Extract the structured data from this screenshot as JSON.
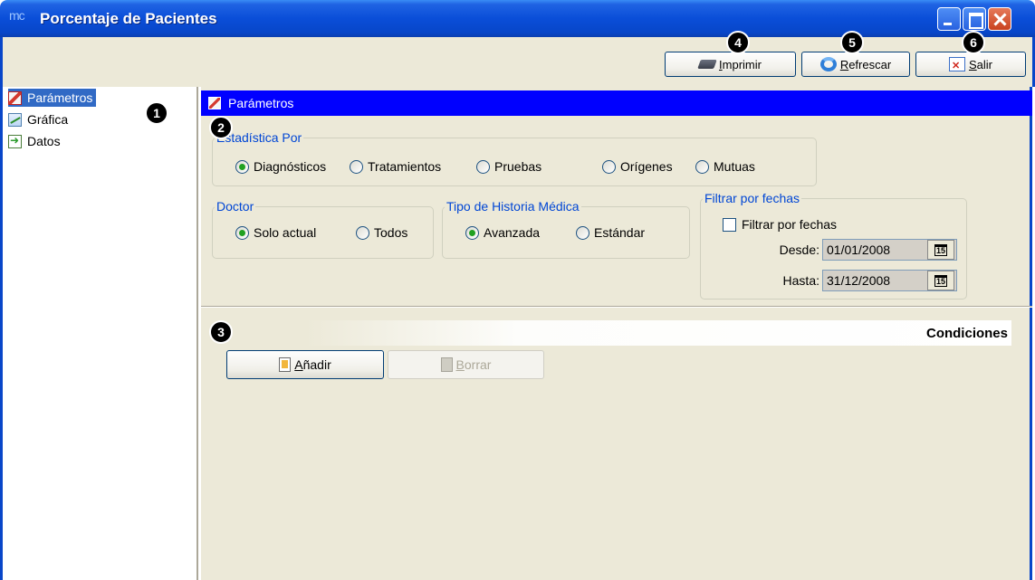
{
  "window": {
    "logo_text": "mc",
    "title": "Porcentaje de Pacientes"
  },
  "toolbar": {
    "print": {
      "mnemonic": "I",
      "rest": "mprimir",
      "icon": "printer-icon"
    },
    "refresh": {
      "mnemonic": "R",
      "rest": "efrescar",
      "icon": "refresh-icon"
    },
    "exit": {
      "mnemonic": "S",
      "rest": "alir",
      "icon": "exit-icon"
    }
  },
  "badges": [
    "1",
    "2",
    "3",
    "4",
    "5",
    "6"
  ],
  "sidebar": {
    "items": [
      {
        "label": "Parámetros",
        "icon": "parameters-icon",
        "selected": true
      },
      {
        "label": "Gráfica",
        "icon": "chart-icon",
        "selected": false
      },
      {
        "label": "Datos",
        "icon": "data-icon",
        "selected": false
      }
    ]
  },
  "main": {
    "header": "Parámetros",
    "statistic": {
      "legend": "Estadística Por",
      "options": [
        "Diagnósticos",
        "Tratamientos",
        "Pruebas",
        "Orígenes",
        "Mutuas"
      ],
      "selected": "Diagnósticos"
    },
    "doctor": {
      "legend": "Doctor",
      "options": [
        "Solo actual",
        "Todos"
      ],
      "selected": "Solo actual"
    },
    "history_type": {
      "legend": "Tipo de Historia Médica",
      "options": [
        "Avanzada",
        "Estándar"
      ],
      "selected": "Avanzada"
    },
    "date_filter": {
      "legend": "Filtrar por fechas",
      "checkbox_label": "Filtrar por fechas",
      "checked": false,
      "from_label": "Desde:",
      "from_value": "01/01/2008",
      "to_label": "Hasta:",
      "to_value": "31/12/2008",
      "calendar_glyph": "15"
    },
    "conditions": {
      "title": "Condiciones",
      "add": {
        "mnemonic": "A",
        "rest": "ñadir"
      },
      "delete": {
        "mnemonic": "B",
        "rest": "orrar",
        "enabled": false
      }
    }
  },
  "colors": {
    "titlebar": "#0846c9",
    "header_bar": "#0000ff",
    "selection": "#316ac5",
    "window_bg": "#ece9d8",
    "legend_text": "#0046d5"
  }
}
